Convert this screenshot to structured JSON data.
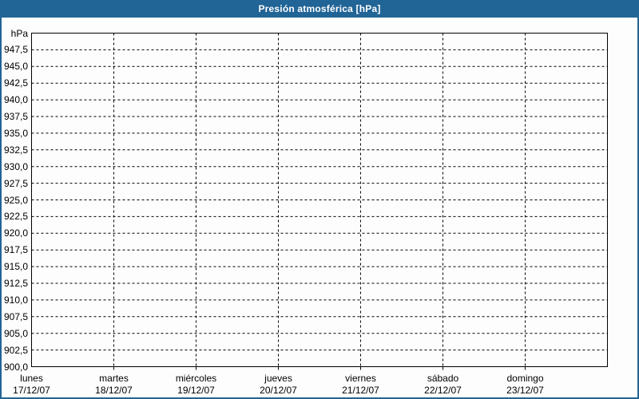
{
  "title": "Presión atmosférica [hPa]",
  "colors": {
    "accent_blue": "#216496",
    "title_text": "#ffffff",
    "grid_line": "#000000",
    "label_text": "#000000",
    "background": "#fdfdfd"
  },
  "chart_data": {
    "type": "line",
    "title": "Presión atmosférica [hPa]",
    "y_unit_label": "hPa",
    "ylim": [
      900,
      950
    ],
    "y_tick_step": 2.5,
    "y_tick_labels": [
      "947,5",
      "945,0",
      "942,5",
      "940,0",
      "937,5",
      "935,0",
      "932,5",
      "930,0",
      "927,5",
      "925,0",
      "922,5",
      "920,0",
      "917,5",
      "915,0",
      "912,5",
      "910,0",
      "907,5",
      "905,0",
      "902,5",
      "900,0"
    ],
    "x_categories": [
      {
        "name": "lunes",
        "date": "17/12/07"
      },
      {
        "name": "martes",
        "date": "18/12/07"
      },
      {
        "name": "miércoles",
        "date": "19/12/07"
      },
      {
        "name": "jueves",
        "date": "20/12/07"
      },
      {
        "name": "viernes",
        "date": "21/12/07"
      },
      {
        "name": "sábado",
        "date": "22/12/07"
      },
      {
        "name": "domingo",
        "date": "23/12/07"
      }
    ],
    "grid": "dashed",
    "legend": "none",
    "series": []
  }
}
